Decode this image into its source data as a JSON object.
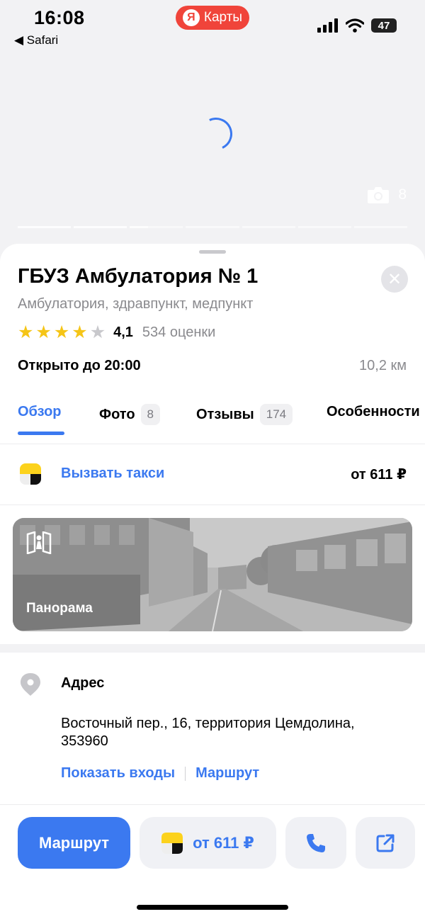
{
  "status_bar": {
    "time": "16:08",
    "back_app": "◀ Safari",
    "app_pill": {
      "logo_letter": "Я",
      "label": "Карты"
    },
    "battery": "47"
  },
  "gallery": {
    "photo_count": "8",
    "segments": 7
  },
  "place": {
    "title": "ГБУЗ Амбулатория № 1",
    "category": "Амбулатория, здравпункт, медпункт",
    "rating_value": "4,1",
    "rating_stars": 4,
    "rating_count": "534 оценки",
    "hours": "Открыто до 20:00",
    "distance": "10,2 км"
  },
  "tabs": [
    {
      "label": "Обзор"
    },
    {
      "label": "Фото",
      "badge": "8"
    },
    {
      "label": "Отзывы",
      "badge": "174"
    },
    {
      "label": "Особенности"
    }
  ],
  "taxi": {
    "label": "Вызвать такси",
    "price": "от 611 ₽"
  },
  "panorama": {
    "label": "Панорама"
  },
  "address": {
    "heading": "Адрес",
    "text": "Восточный пер., 16, территория Цемдолина, 353960",
    "link_entrances": "Показать входы",
    "link_route": "Маршрут"
  },
  "actions": {
    "route": "Маршрут",
    "taxi_price": "от 611 ₽"
  },
  "colors": {
    "accent": "#3b79f0",
    "star": "#f5c517",
    "brand_red": "#f0443a"
  }
}
